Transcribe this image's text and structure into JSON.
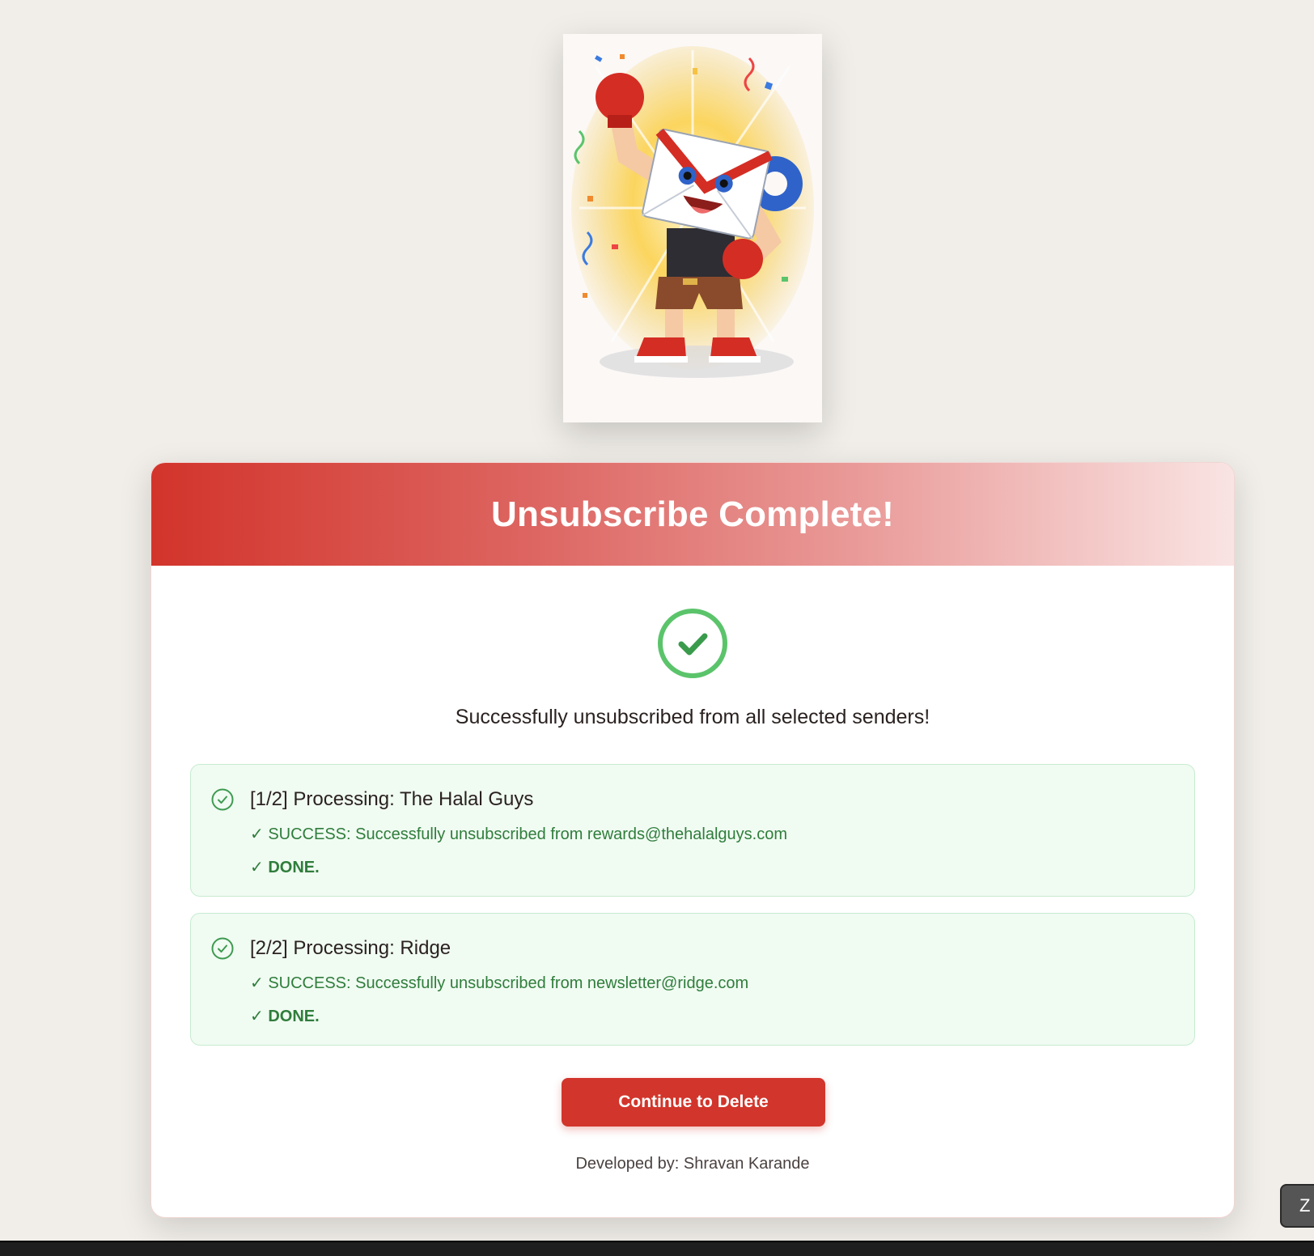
{
  "colors": {
    "brand_red": "#d2352b",
    "success_green": "#2f7d3b",
    "badge_green": "#5bc46b",
    "log_background": "#f0fbf2"
  },
  "mascot": {
    "icon": "envelope-mascot-illustration"
  },
  "header": {
    "title": "Unsubscribe Complete!"
  },
  "status": {
    "icon": "check-circle-icon",
    "message": "Successfully unsubscribed from all selected senders!"
  },
  "results": [
    {
      "title": "[1/2] Processing: The Halal Guys",
      "success": "✓ SUCCESS: Successfully unsubscribed from rewards@thehalalguys.com",
      "done": "✓ DONE."
    },
    {
      "title": "[2/2] Processing: Ridge",
      "success": "✓ SUCCESS: Successfully unsubscribed from newsletter@ridge.com",
      "done": "✓ DONE."
    }
  ],
  "actions": {
    "continue_label": "Continue to Delete"
  },
  "footer": {
    "credit": "Developed by: Shravan Karande"
  },
  "corner_button": {
    "label": "Z"
  }
}
